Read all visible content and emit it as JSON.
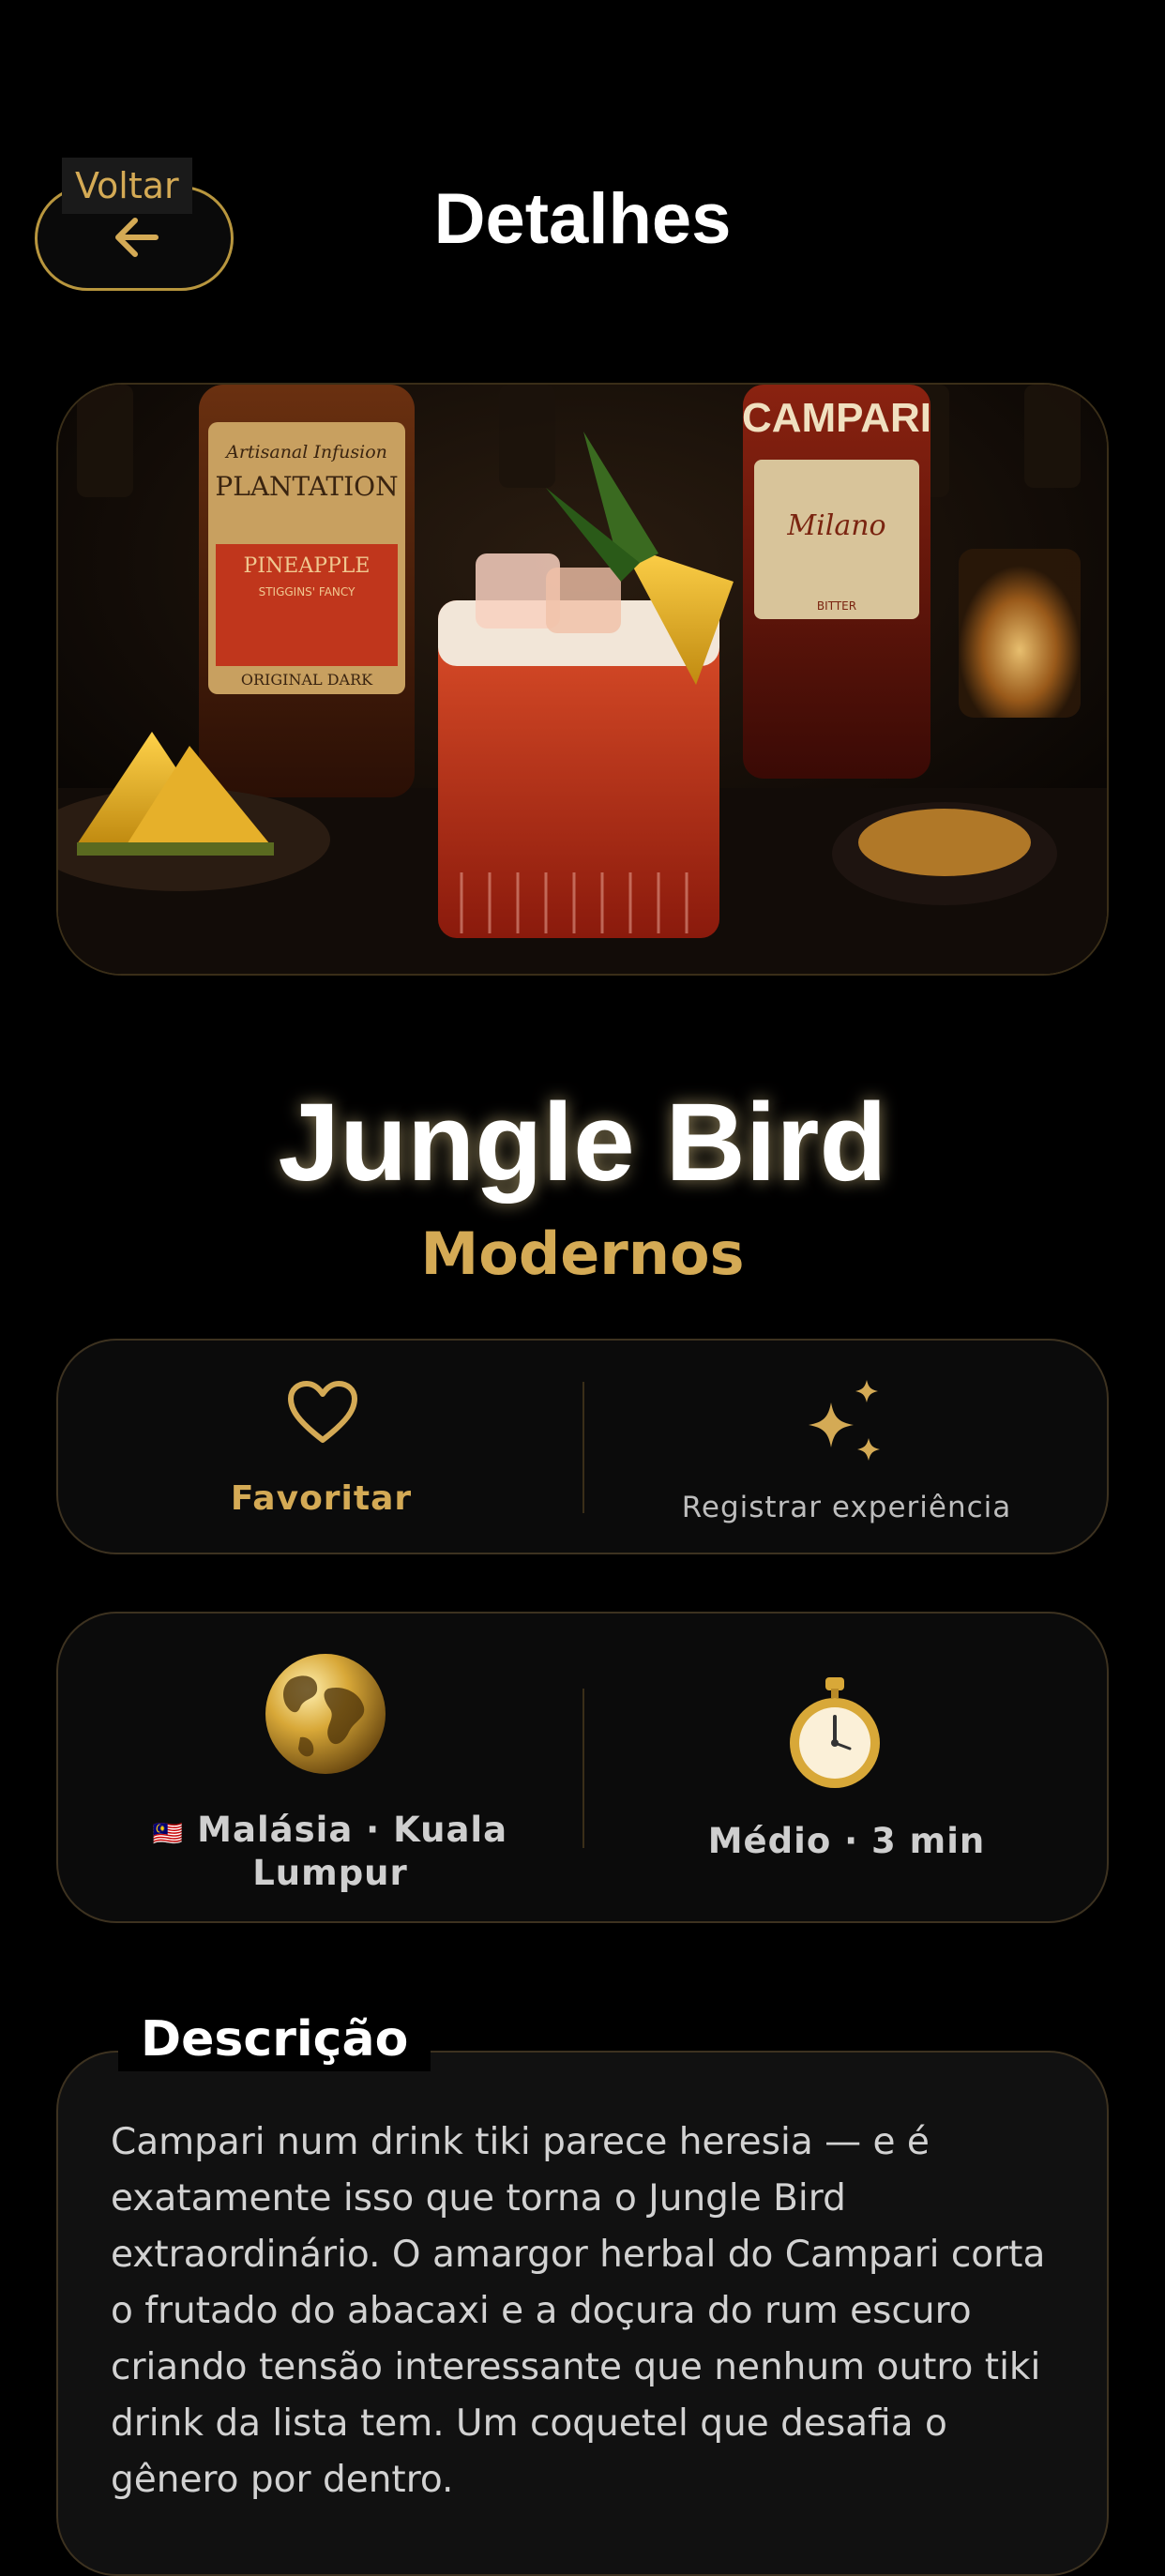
{
  "header": {
    "back_label": "Voltar",
    "title": "Detalhes"
  },
  "drink": {
    "name": "Jungle Bird",
    "category": "Modernos",
    "image_text": {
      "plantation_top": "Artisanal Infusion",
      "plantation_brand": "PLANTATION",
      "plantation_flavor": "PINEAPPLE",
      "plantation_sub": "STIGGINS' FANCY",
      "plantation_bottom": "ORIGINAL DARK",
      "campari_brand": "CAMPARI",
      "campari_city": "Milano",
      "campari_type": "BITTER"
    }
  },
  "actions": {
    "favorite_label": "Favoritar",
    "register_label": "Registrar experiência",
    "favorite_icon": "heart-icon",
    "register_icon": "sparkles-icon"
  },
  "info": {
    "flag": "🇲🇾",
    "origin_line1": "Malásia · Kuala",
    "origin_line2": "Lumpur",
    "difficulty_time": "Médio · 3 min",
    "origin_icon": "globe-icon",
    "time_icon": "stopwatch-icon"
  },
  "description": {
    "title": "Descrição",
    "text": "Campari num drink tiki parece heresia — e é exatamente isso que torna o Jungle Bird extraordinário. O amargor herbal do Campari corta o frutado do abacaxi e a doçura do rum escuro criando tensão interessante que nenhum outro tiki drink da lista tem. Um coquetel que desafia o gênero por dentro."
  },
  "colors": {
    "background": "#000000",
    "accent_gold": "#d4aa55",
    "card_border": "#3d3220",
    "text_primary": "#ffffff",
    "text_secondary": "#d2d2d2"
  }
}
